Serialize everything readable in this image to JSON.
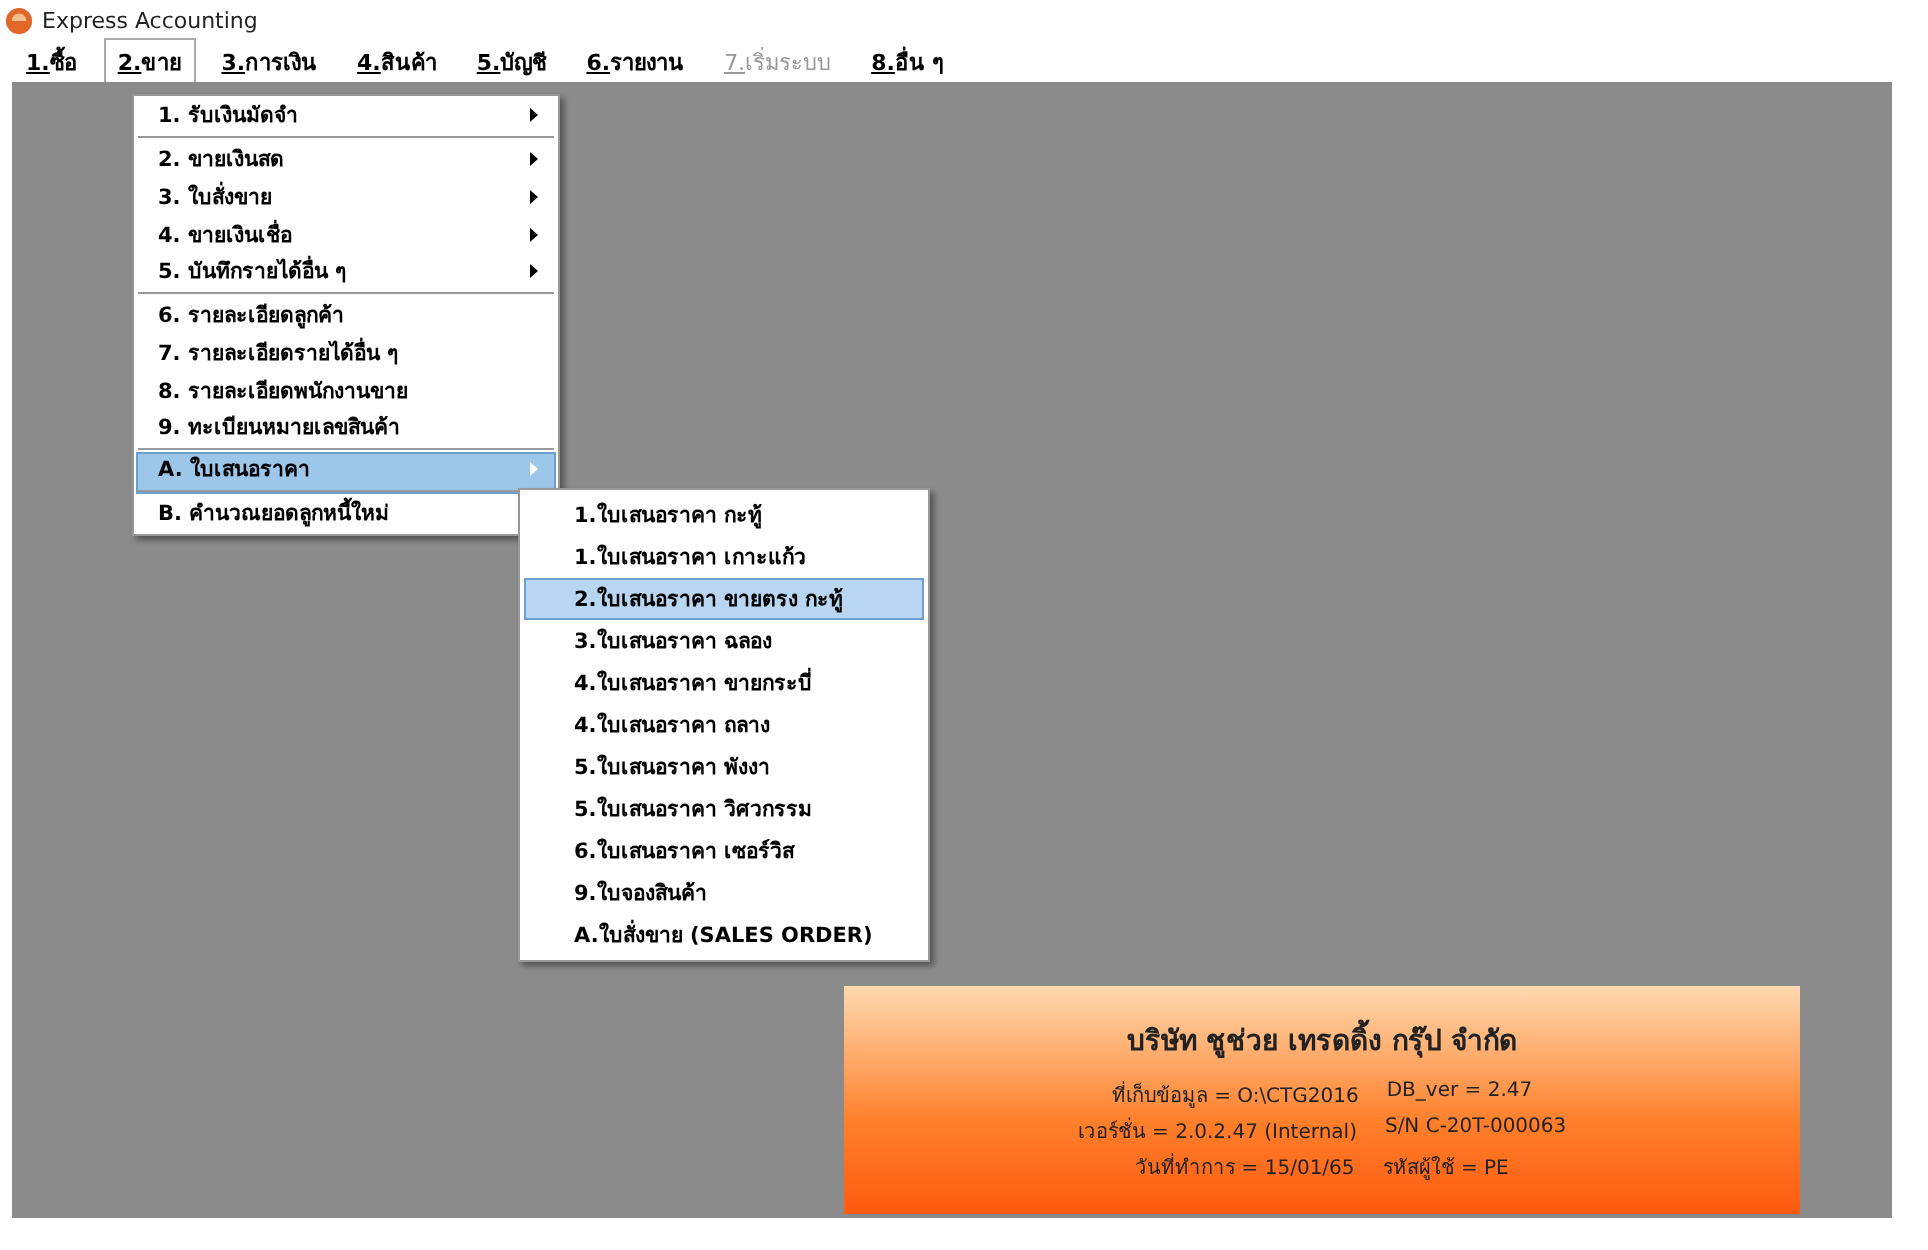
{
  "window": {
    "title": "Express Accounting"
  },
  "menu_bar": [
    {
      "label": "1.ซื้อ",
      "selected": false,
      "disabled": false
    },
    {
      "label": "2.ขาย",
      "selected": true,
      "disabled": false
    },
    {
      "label": "3.การเงิน",
      "selected": false,
      "disabled": false
    },
    {
      "label": "4.สินค้า",
      "selected": false,
      "disabled": false
    },
    {
      "label": "5.บัญชี",
      "selected": false,
      "disabled": false
    },
    {
      "label": "6.รายงาน",
      "selected": false,
      "disabled": false
    },
    {
      "label": "7.เริ่มระบบ",
      "selected": false,
      "disabled": true
    },
    {
      "label": "8.อื่น ๆ",
      "selected": false,
      "disabled": false
    }
  ],
  "menu": [
    {
      "label": "1. รับเงินมัดจำ",
      "submenu": true,
      "separator_after": true,
      "selected": false
    },
    {
      "label": "2. ขายเงินสด",
      "submenu": true,
      "separator_after": false,
      "selected": false
    },
    {
      "label": "3. ใบสั่งขาย",
      "submenu": true,
      "separator_after": false,
      "selected": false
    },
    {
      "label": "4. ขายเงินเชื่อ",
      "submenu": true,
      "separator_after": false,
      "selected": false
    },
    {
      "label": "5. บันทึกรายได้อื่น ๆ",
      "submenu": true,
      "separator_after": true,
      "selected": false
    },
    {
      "label": "6. รายละเอียดลูกค้า",
      "submenu": false,
      "separator_after": false,
      "selected": false
    },
    {
      "label": "7. รายละเอียดรายได้อื่น ๆ",
      "submenu": false,
      "separator_after": false,
      "selected": false
    },
    {
      "label": "8. รายละเอียดพนักงานขาย",
      "submenu": false,
      "separator_after": false,
      "selected": false
    },
    {
      "label": "9. ทะเบียนหมายเลขสินค้า",
      "submenu": false,
      "separator_after": true,
      "selected": false
    },
    {
      "label": "A. ใบเสนอราคา",
      "submenu": true,
      "separator_after": true,
      "selected": true
    },
    {
      "label": "B. คำนวณยอดลูกหนี้ใหม่",
      "separator_after": false,
      "selected": false
    }
  ],
  "submenu": [
    {
      "label": "1.ใบเสนอราคา กะทู้",
      "selected": false
    },
    {
      "label": "1.ใบเสนอราคา เกาะแก้ว",
      "selected": false
    },
    {
      "label": "2.ใบเสนอราคา ขายตรง กะทู้",
      "selected": true
    },
    {
      "label": "3.ใบเสนอราคา ฉลอง",
      "selected": false
    },
    {
      "label": "4.ใบเสนอราคา ขายกระบี่",
      "selected": false
    },
    {
      "label": "4.ใบเสนอราคา ถลาง",
      "selected": false
    },
    {
      "label": "5.ใบเสนอราคา พังงา",
      "selected": false
    },
    {
      "label": "5.ใบเสนอราคา วิศวกรรม",
      "selected": false
    },
    {
      "label": "6.ใบเสนอราคา เซอร์วิส",
      "selected": false
    },
    {
      "label": "9.ใบจองสินค้า",
      "selected": false
    },
    {
      "label": "A.ใบสั่งขาย (SALES ORDER)",
      "selected": false
    }
  ],
  "info_panel": {
    "company": "บริษัท ชูช่วย เทรดดิ้ง กรุ๊ป จำกัด",
    "lines": [
      [
        "ที่เก็บข้อมูล = O:\\CTG2016",
        "DB_ver = 2.47"
      ],
      [
        "เวอร์ชั่น =  2.0.2.47 (Internal)",
        "S/N C-20T-000063"
      ],
      [
        "วันที่ทำการ  =  15/01/65",
        "รหัสผู้ใช้  =  PE"
      ]
    ]
  }
}
